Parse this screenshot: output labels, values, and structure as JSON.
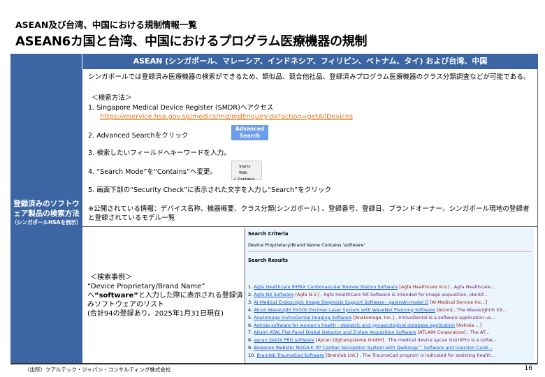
{
  "header": {
    "subtitle": "ASEAN及び台湾、中国における規制情報一覧",
    "title": "ASEAN6カ国と台湾、中国におけるプログラム医療機器の規制"
  },
  "table": {
    "column_header": "ASEAN (シンガポール、マレーシア、インドネシア、フィリピン、ベトナム、タイ) および台湾、中国",
    "row_label": "登録済みのソフトウェア製品の検索方法",
    "row_label_note": "（シンガポールHSAを例示）",
    "intro": "シンガポールでは登録済み医療機器の検索ができるため、類似品、競合他社品、登録済みプログラム医療機器のクラス分類調査などが可能である。",
    "method_heading": "＜検索方法＞",
    "steps": [
      {
        "text": "1.  Singapore Medical Device Register (SMDR)へアクセス",
        "link": "https://eservice.hsa.gov.sg/medics/md/mdEnquiry.do?action=getAllDevices"
      },
      {
        "text": "2.  Advanced Searchをクリック"
      },
      {
        "text": "3.  検索したいフィールドへキーワードを入力。"
      },
      {
        "text": "4.  “Search Mode”を“Contains”へ変更。"
      },
      {
        "text": "5.  画面下部の“Security Check”に表示された文字を入力し“Search”をクリック"
      }
    ],
    "advanced_button": {
      "line1": "Advanced",
      "line2": "Search"
    },
    "mode_options": [
      "Starts With",
      "✓ Contains"
    ],
    "note": "※公開されている情報：デバイス名称、機器概要、クラス分類(シンガポール) 、登録番号、登録日、ブランドオーナー、シンガポール現地の登録者と登録されているモデル一覧",
    "example": {
      "heading": "＜検索事例＞",
      "line1": "“Device Proprietary/Brand Name”",
      "line2_pre": "へ",
      "line2_bold": "“software”",
      "line2_post": "と入力した際に表示される登録済みソフトウェアのリスト",
      "line3": "(合計94の登録あり。2025年1月31日現在)"
    },
    "search": {
      "criteria_heading": "Search Criteria",
      "criteria": "Device Proprietary/Brand Name Contains 'software'",
      "results_heading": "Search Results",
      "results": [
        {
          "n": "1.",
          "name": "Agfa Healthcare IMPAX Cardiovascular Review Station Software",
          "company": "[Agfa Healthcare N.V.]",
          "desc": ", Agfa Healthcare..."
        },
        {
          "n": "2.",
          "name": "Agfa NX Software",
          "company": "[Agfa N.V.]",
          "desc": ", Agfa HealthCare NX Software is intended for image acquisition, identif..."
        },
        {
          "n": "3.",
          "name": "AI Medical Endoscopic Image Diagnosis Support Software - gastroAI-model G",
          "company": "[AI Medical Service Inc...]",
          "desc": ""
        },
        {
          "n": "4.",
          "name": "Alcon WaveLight EX500 Excimer Laser System with WaveNet Planning Software",
          "company": "[Alcon]",
          "desc": ", The WaveLight® EX..."
        },
        {
          "n": "5.",
          "name": "Anatomage InVivoDental Imaging Software",
          "company": "[Anatomage, Inc.]",
          "desc": ", InVivoDental is a software application us..."
        },
        {
          "n": "6.",
          "name": "Astraia software for women's health - obstetric and gynaecological database application",
          "company": "[Astraia ...]",
          "desc": ""
        },
        {
          "n": "7.",
          "name": "Atlaim ATAL Flat Panel Digital Detector and Z-View Acquisition Software",
          "company": "[ATLAIM Corporation]",
          "desc": ", The AT..."
        },
        {
          "n": "8.",
          "name": "aycan OsiriX PRO software",
          "company": "[Aycan Digitalsysteme GmbH]",
          "desc": ", The medical device aycan OsiriXPro is a softw..."
        },
        {
          "n": "9.",
          "name": "Biosense Webster NOGA® XP Cardiac Navigation System with Qwikmap™ Software and Injection Cardi...",
          "company": "",
          "desc": ""
        },
        {
          "n": "10.",
          "name": "Brainlab TraumaCad Software",
          "company": "[Brainlab Ltd.]",
          "desc": ", The TraumaCad program is indicated for assisting health..."
        }
      ]
    }
  },
  "footer": {
    "source": "（出所）クアルテック・ジャパン・コンサルティング株式会社",
    "page": "16"
  }
}
